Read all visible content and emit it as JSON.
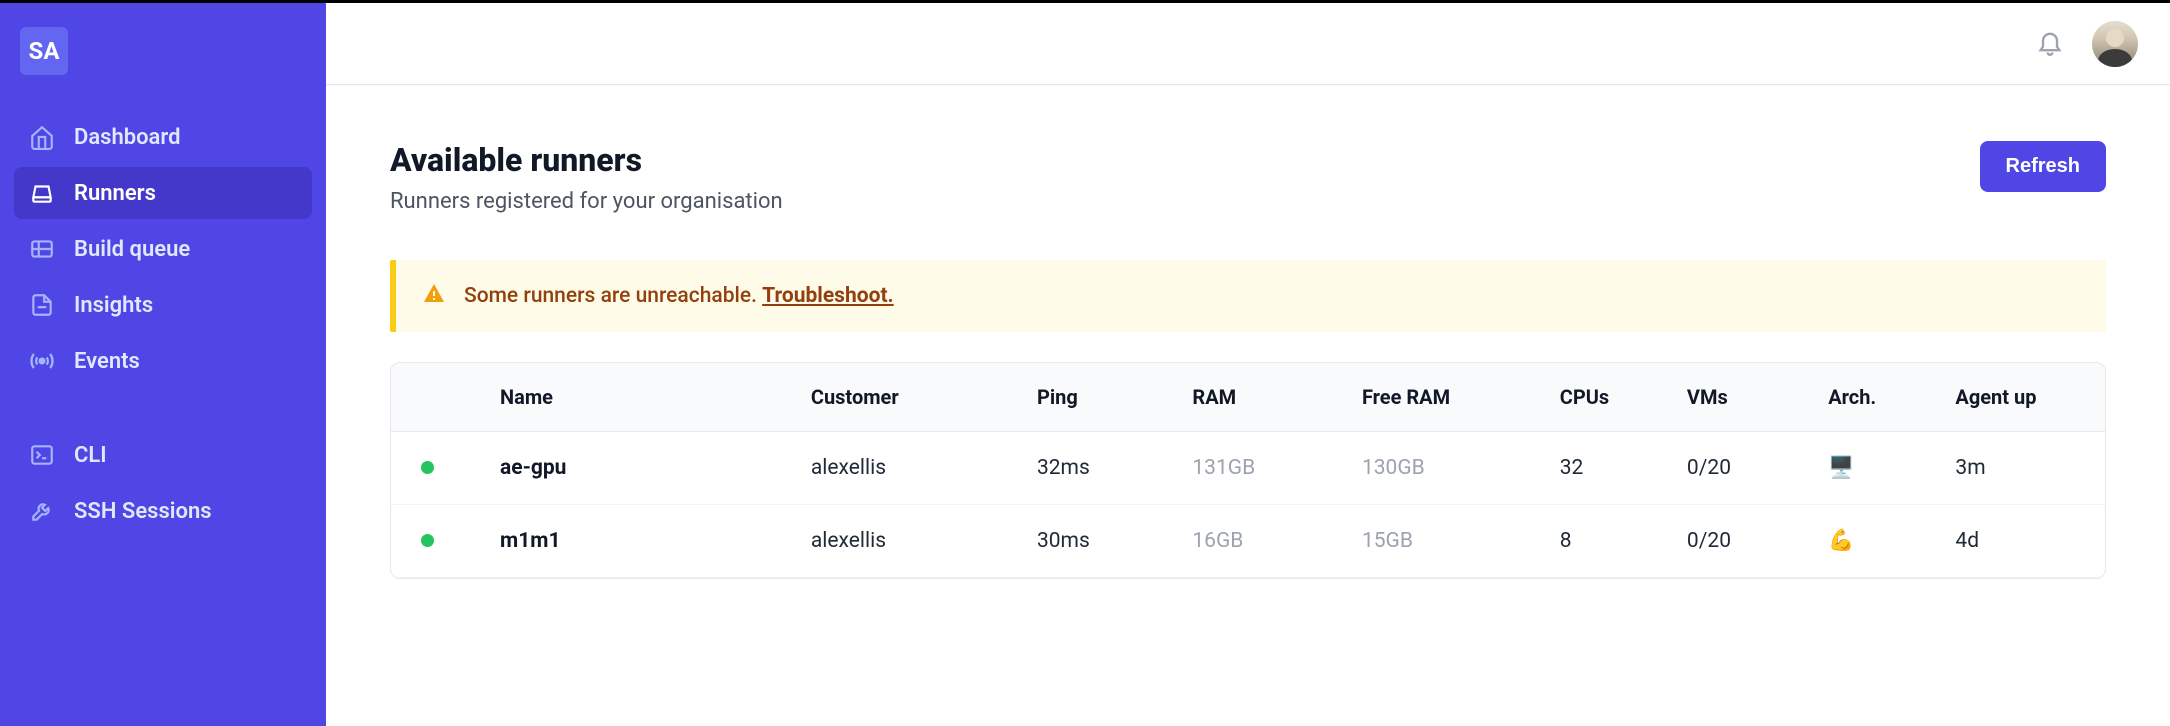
{
  "brand": {
    "logo_text": "SA"
  },
  "sidebar": {
    "group1": [
      {
        "label": "Dashboard",
        "icon": "home-icon",
        "active": false
      },
      {
        "label": "Runners",
        "icon": "disk-icon",
        "active": true
      },
      {
        "label": "Build queue",
        "icon": "grid-icon",
        "active": false
      },
      {
        "label": "Insights",
        "icon": "file-icon",
        "active": false
      },
      {
        "label": "Events",
        "icon": "broadcast-icon",
        "active": false
      }
    ],
    "group2": [
      {
        "label": "CLI",
        "icon": "terminal-icon",
        "active": false
      },
      {
        "label": "SSH Sessions",
        "icon": "wrench-icon",
        "active": false
      }
    ]
  },
  "page": {
    "title": "Available runners",
    "subtitle": "Runners registered for your organisation",
    "refresh_label": "Refresh"
  },
  "alert": {
    "text": "Some runners are unreachable. ",
    "link": "Troubleshoot."
  },
  "table": {
    "headers": {
      "name": "Name",
      "customer": "Customer",
      "ping": "Ping",
      "ram": "RAM",
      "free_ram": "Free RAM",
      "cpus": "CPUs",
      "vms": "VMs",
      "arch": "Arch.",
      "agent_up": "Agent up"
    },
    "rows": [
      {
        "status": "green",
        "name": "ae-gpu",
        "customer": "alexellis",
        "ping": "32ms",
        "ram": "131GB",
        "free_ram": "130GB",
        "cpus": "32",
        "vms": "0/20",
        "arch": "🖥️",
        "agent_up": "3m"
      },
      {
        "status": "green",
        "name": "m1m1",
        "customer": "alexellis",
        "ping": "30ms",
        "ram": "16GB",
        "free_ram": "15GB",
        "cpus": "8",
        "vms": "0/20",
        "arch": "💪",
        "agent_up": "4d"
      }
    ]
  }
}
